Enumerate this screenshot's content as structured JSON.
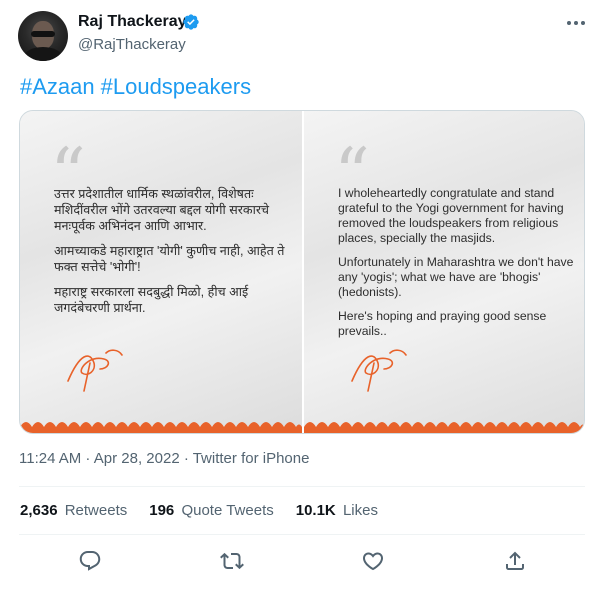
{
  "author": {
    "name": "Raj Thackeray",
    "handle": "@RajThackeray",
    "verified_color": "#1d9bf0"
  },
  "tweet": {
    "hashtags": [
      "#Azaan",
      "#Loudspeakers"
    ],
    "timestamp": "11:24 AM · Apr 28, 2022 · Twitter for iPhone"
  },
  "media": {
    "left_paragraphs": [
      "उत्तर प्रदेशातील धार्मिक स्थळांवरील, विशेषतः मशिदींवरील भोंगे उतरवल्या बद्दल योगी सरकारचे मनःपूर्वक अभिनंदन आणि आभार.",
      "आमच्याकडे महाराष्ट्रात 'योगी' कुणीच नाही, आहेत ते फक्त सत्तेचे 'भोगी'!",
      "महाराष्ट्र सरकारला सदबुद्धी मिळो, हीच आई जगदंबेचरणी प्रार्थना."
    ],
    "right_paragraphs": [
      "I wholeheartedly congratulate and stand grateful to the Yogi government for having removed the loudspeakers from religious places, specially the masjids.",
      "Unfortunately in Maharashtra we don't have any 'yogis'; what we have are 'bhogis' (hedonists).",
      "Here's hoping and praying good sense prevails.."
    ],
    "accent_color": "#e8622a"
  },
  "stats": {
    "retweets_count": "2,636",
    "retweets_label": "Retweets",
    "quotes_count": "196",
    "quotes_label": "Quote Tweets",
    "likes_count": "10.1K",
    "likes_label": "Likes"
  },
  "icons": [
    "more-icon",
    "verified-icon",
    "reply-icon",
    "retweet-icon",
    "like-icon",
    "share-icon"
  ]
}
